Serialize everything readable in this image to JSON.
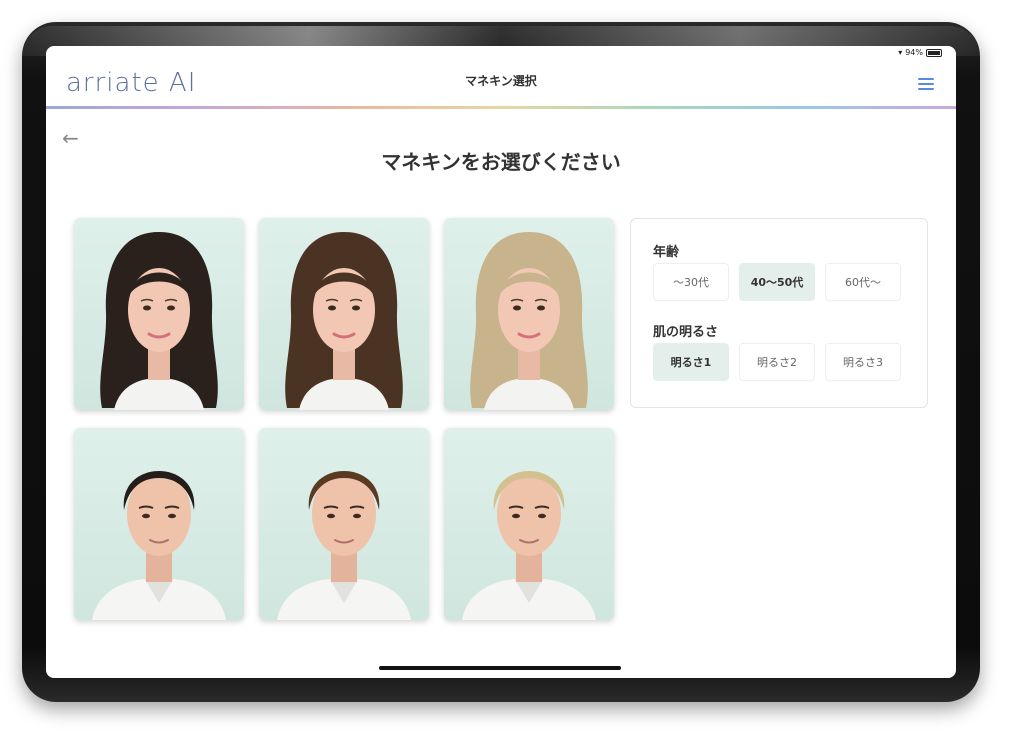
{
  "status": {
    "battery": "94%"
  },
  "app": {
    "logo": "arriate AI",
    "title": "マネキン選択"
  },
  "page": {
    "heading": "マネキンをお選びください"
  },
  "filters": {
    "age": {
      "label": "年齢",
      "options": [
        "〜30代",
        "40〜50代",
        "60代〜"
      ],
      "selected": 1
    },
    "skin": {
      "label": "肌の明るさ",
      "options": [
        "明るさ1",
        "明るさ2",
        "明るさ3"
      ],
      "selected": 0
    }
  },
  "mannequins": [
    {
      "gender": "female",
      "hair_color": "#2a211d"
    },
    {
      "gender": "female",
      "hair_color": "#4a3323"
    },
    {
      "gender": "female",
      "hair_color": "#c7b38c"
    },
    {
      "gender": "male",
      "hair_color": "#241d19"
    },
    {
      "gender": "male",
      "hair_color": "#5a3a22"
    },
    {
      "gender": "male",
      "hair_color": "#d2c08f"
    }
  ],
  "colors": {
    "accent": "#5a8ae0",
    "selected_bg": "#e4efec",
    "logo": "#5d6f9e"
  }
}
